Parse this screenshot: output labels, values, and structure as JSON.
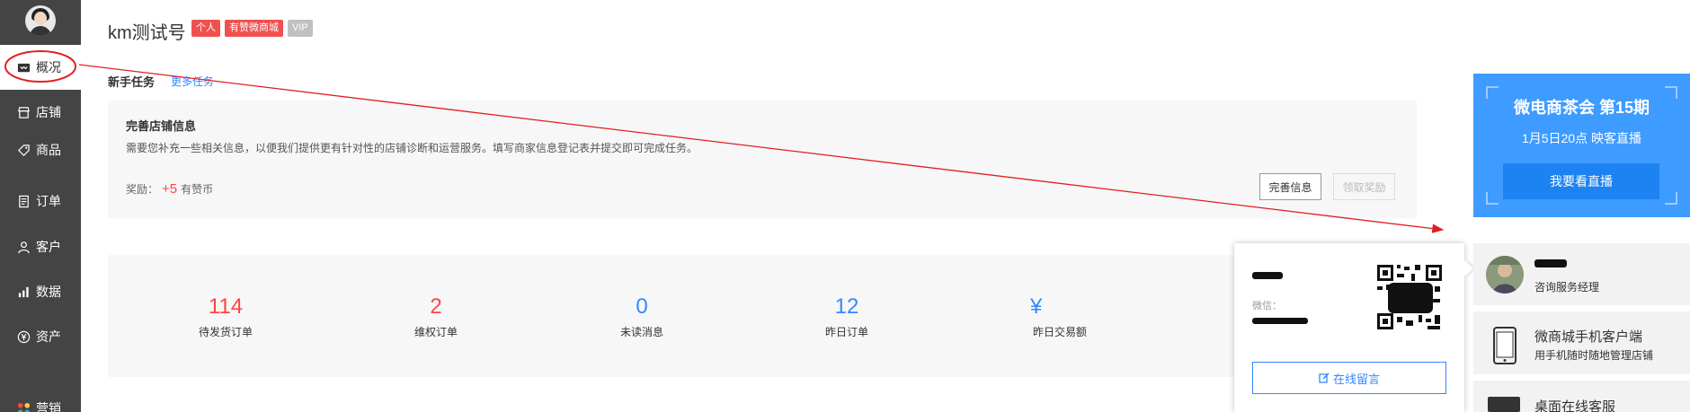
{
  "sidebar": {
    "items": [
      {
        "label": "概况",
        "icon": "overview-icon"
      },
      {
        "label": "店铺",
        "icon": "store-icon"
      },
      {
        "label": "商品",
        "icon": "tag-icon"
      },
      {
        "label": "订单",
        "icon": "order-icon"
      },
      {
        "label": "客户",
        "icon": "user-icon"
      },
      {
        "label": "数据",
        "icon": "bar-chart-icon"
      },
      {
        "label": "资产",
        "icon": "yuan-icon"
      },
      {
        "label": "营销",
        "icon": "marketing-icon"
      }
    ]
  },
  "header": {
    "title": "km测试号",
    "badges": [
      "个人",
      "有赞微商城",
      "VIP"
    ]
  },
  "tasks": {
    "section_title": "新手任务",
    "more_link": "更多任务",
    "card": {
      "title": "完善店铺信息",
      "description": "需要您补充一些相关信息，以便我们提供更有针对性的店铺诊断和运营服务。填写商家信息登记表并提交即可完成任务。",
      "reward_label": "奖励：",
      "reward_value": "+5",
      "reward_unit": "有赞币",
      "complete_button": "完善信息",
      "claim_button": "领取奖励"
    }
  },
  "stats": [
    {
      "value": "114",
      "label": "待发货订单"
    },
    {
      "value": "2",
      "label": "维权订单"
    },
    {
      "value": "0",
      "label": "未读消息"
    },
    {
      "value": "12",
      "label": "昨日订单"
    },
    {
      "value": "¥",
      "label": "昨日交易额"
    }
  ],
  "popup": {
    "wechat_label": "微信：",
    "message_button": "在线留言"
  },
  "promo": {
    "title": "微电商茶会  第15期",
    "subtitle": "1月5日20点  映客直播",
    "button": "我要看直播"
  },
  "manager": {
    "role": "咨询服务经理"
  },
  "mobile_client": {
    "title": "微商城手机客户端",
    "subtitle": "用手机随时随地管理店铺"
  },
  "desktop_service": {
    "title": "桌面在线客服"
  },
  "colors": {
    "sidebar_bg": "#444444",
    "accent_blue": "#3388ff",
    "promo_blue": "#3e9bff",
    "alert_red": "#ff4444",
    "annotation_red": "#e02020"
  }
}
